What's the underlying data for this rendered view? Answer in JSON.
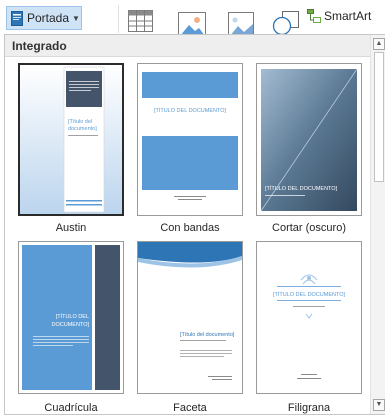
{
  "ribbon": {
    "cover_page_label": "Portada",
    "smartart_label": "SmartArt"
  },
  "gallery": {
    "section_title": "Integrado",
    "items": [
      {
        "name": "Austin",
        "title_text": "[Título del documento]"
      },
      {
        "name": "Con bandas",
        "title_text": "[TÍTULO DEL DOCUMENTO]"
      },
      {
        "name": "Cortar (oscuro)",
        "title_text": "[TÍTULO DEL DOCUMENTO]"
      },
      {
        "name": "Cuadrícula",
        "title_text_line1": "[TÍTULO DEL",
        "title_text_line2": "DOCUMENTO]"
      },
      {
        "name": "Faceta",
        "title_text": "[Título del documento]"
      },
      {
        "name": "Filigrana",
        "title_text": "[TÍTULO DEL DOCUMENTO]"
      }
    ]
  },
  "colors": {
    "accent": "#2e75b6",
    "cover_blue": "#5b9bd5",
    "dark_slate": "#44546a"
  },
  "icons": [
    "cover-page-icon",
    "table-icon",
    "picture-icon",
    "online-picture-icon",
    "shapes-icon",
    "smartart-icon",
    "scroll-up-icon",
    "scroll-down-icon"
  ]
}
